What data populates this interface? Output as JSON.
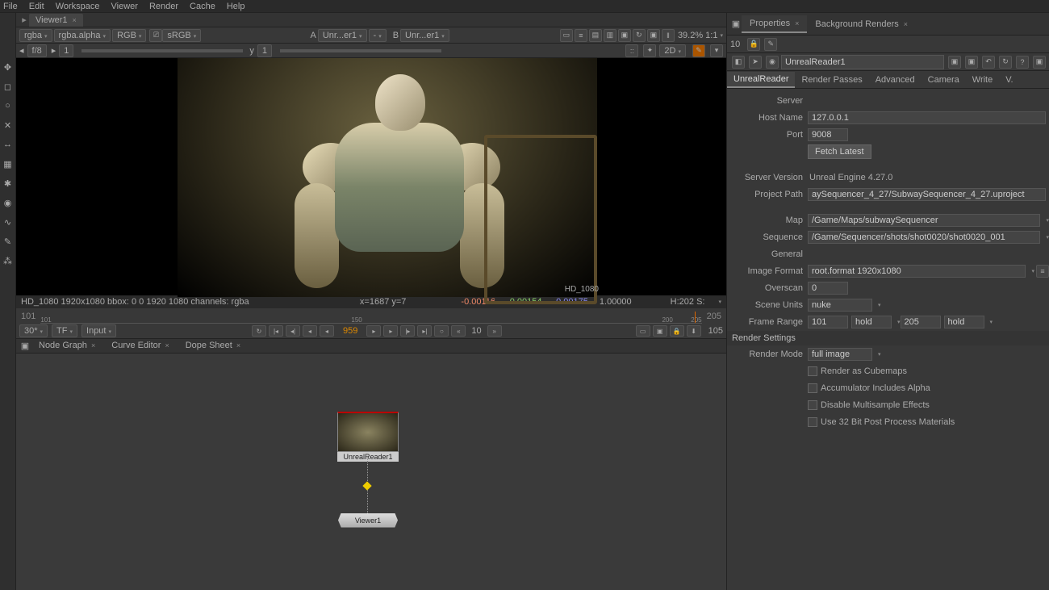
{
  "menubar": [
    "File",
    "Edit",
    "Workspace",
    "Viewer",
    "Render",
    "Cache",
    "Help"
  ],
  "viewer_tab": "Viewer1",
  "channel": {
    "layer": "rgba",
    "alpha": "rgba.alpha",
    "rgb": "RGB",
    "cs": "sRGB"
  },
  "input_a": {
    "label": "A",
    "src": "Unr...er1",
    "dash": "-"
  },
  "input_b": {
    "label": "B",
    "src": "Unr...er1"
  },
  "zoom": "39.2%  1:1",
  "fstop": {
    "arrow": "◂",
    "f": "f/8",
    "gamma": "1",
    "y": "y",
    "yval": "1",
    "mode": "2D"
  },
  "res_overlay": "HD_1080",
  "info": {
    "res": "HD_1080 1920x1080  bbox: 0 0 1920 1080 channels: rgba",
    "xy": "x=1687 y=7",
    "r": "-0.00116",
    "g": "-0.00154",
    "b": "-0.00175",
    "a": "1.00000",
    "hsv": "H:202 S:"
  },
  "timeline": {
    "start": "101",
    "start2": "101",
    "end": "205",
    "end2": "205",
    "mid1": "150",
    "mid2": "200"
  },
  "playback": {
    "fps": "30*",
    "tf": "TF",
    "input": "Input",
    "frame": "959",
    "j": "10",
    "tot": "105"
  },
  "graph_tabs": [
    "Node Graph",
    "Curve Editor",
    "Dope Sheet"
  ],
  "nodes": {
    "ur": "UnrealReader1",
    "viewer": "Viewer1"
  },
  "right_tabs": [
    "Properties",
    "Background Renders"
  ],
  "right_toolbar_num": "10",
  "node_name": "UnrealReader1",
  "sec_tabs": [
    "UnrealReader",
    "Render Passes",
    "Advanced",
    "Camera",
    "Write",
    "V."
  ],
  "props": {
    "server_hdr": "Server",
    "host_label": "Host Name",
    "host": "127.0.0.1",
    "port_label": "Port",
    "port": "9008",
    "fetch": "Fetch Latest",
    "sv_label": "Server Version",
    "sv": "Unreal Engine 4.27.0",
    "pp_label": "Project Path",
    "pp": "aySequencer_4_27/SubwaySequencer_4_27.uproject",
    "map_label": "Map",
    "map": "/Game/Maps/subwaySequencer",
    "seq_label": "Sequence",
    "seq": "/Game/Sequencer/shots/shot0020/shot0020_001",
    "general_hdr": "General",
    "if_label": "Image Format",
    "if": "root.format 1920x1080",
    "os_label": "Overscan",
    "os": "0",
    "su_label": "Scene Units",
    "su": "nuke",
    "fr_label": "Frame Range",
    "fr1": "101",
    "fr1m": "hold",
    "fr2": "205",
    "fr2m": "hold",
    "rs_hdr": "Render Settings",
    "rm_label": "Render Mode",
    "rm": "full image",
    "cb1": "Render as Cubemaps",
    "cb2": "Accumulator Includes Alpha",
    "cb3": "Disable Multisample Effects",
    "cb4": "Use 32 Bit Post Process Materials"
  }
}
